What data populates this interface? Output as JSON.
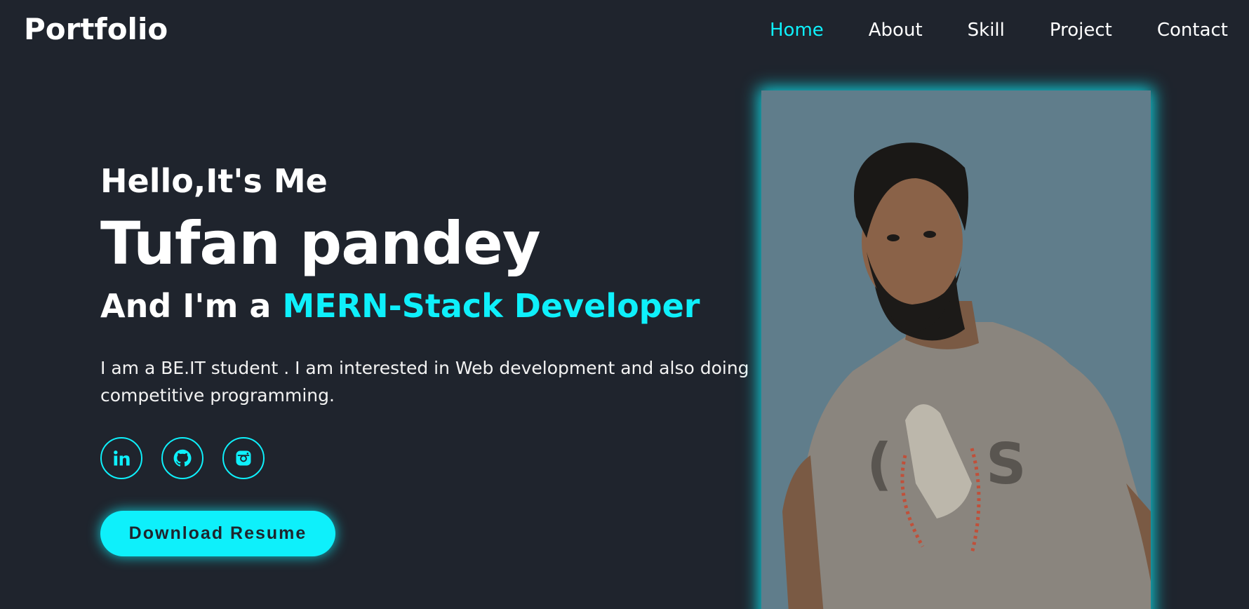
{
  "header": {
    "logo": "Portfolio",
    "nav": [
      {
        "label": "Home",
        "active": true
      },
      {
        "label": "About",
        "active": false
      },
      {
        "label": "Skill",
        "active": false
      },
      {
        "label": "Project",
        "active": false
      },
      {
        "label": "Contact",
        "active": false
      }
    ]
  },
  "hero": {
    "greeting": "Hello,It's Me",
    "name": "Tufan pandey",
    "role_prefix": "And I'm a ",
    "role_highlight": "MERN-Stack Developer",
    "description": "I am a BE.IT student . I am interested in Web development and also doing competitive programming.",
    "socials": [
      {
        "icon": "linkedin-icon"
      },
      {
        "icon": "github-icon"
      },
      {
        "icon": "instagram-icon"
      }
    ],
    "button_label": "Download Resume"
  },
  "colors": {
    "background": "#1f242d",
    "accent": "#0ef0fb",
    "text": "#ffffff",
    "photo_bg": "#607d8b"
  }
}
